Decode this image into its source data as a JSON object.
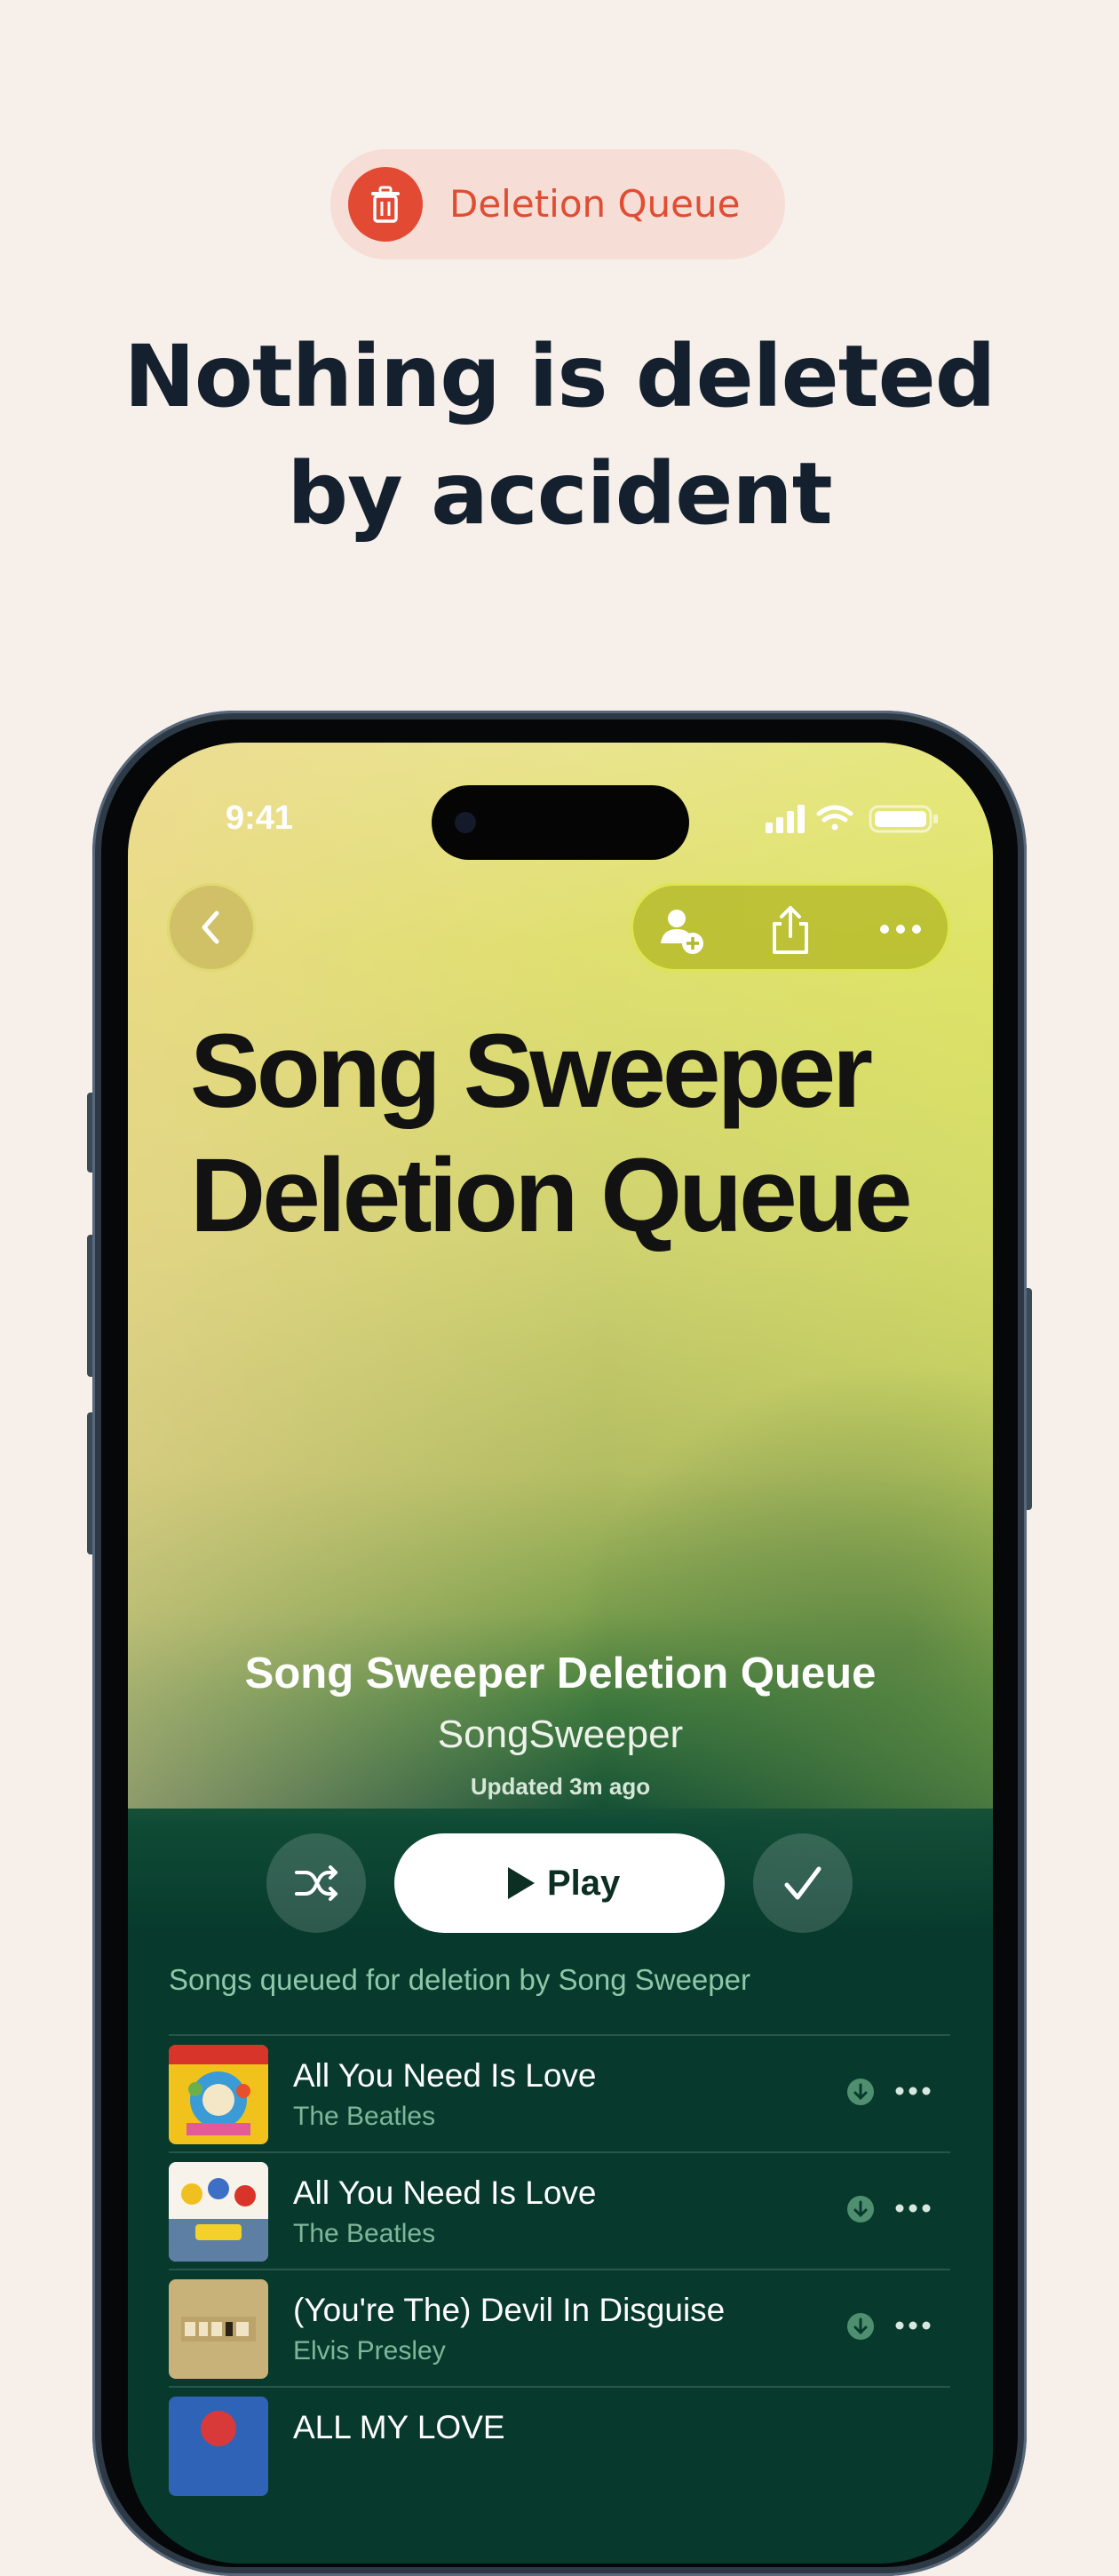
{
  "badge": {
    "label": "Deletion Queue",
    "icon": "trash-icon",
    "color": "#e24a33"
  },
  "headline": {
    "line1": "Nothing is deleted",
    "line2": "by accident"
  },
  "status_bar": {
    "time": "9:41"
  },
  "nav": {
    "back_icon": "chevron-left-icon",
    "actions": [
      "add-person-icon",
      "share-icon",
      "more-icon"
    ]
  },
  "cover_title": {
    "line1": "Song Sweeper",
    "line2": "Deletion Queue"
  },
  "playlist": {
    "name": "Song Sweeper Deletion Queue",
    "owner": "SongSweeper",
    "updated": "Updated 3m ago",
    "play_label": "Play",
    "description": "Songs queued for deletion by Song Sweeper"
  },
  "tracks": [
    {
      "title": "All You Need Is Love",
      "artist": "The Beatles"
    },
    {
      "title": "All You Need Is Love",
      "artist": "The Beatles"
    },
    {
      "title": "(You're The) Devil In Disguise",
      "artist": "Elvis Presley"
    },
    {
      "title": "ALL MY LOVE",
      "artist": ""
    }
  ],
  "colors": {
    "page_bg": "#f7efe9",
    "accent": "#e24a33",
    "list_bg": "#073a2c"
  }
}
